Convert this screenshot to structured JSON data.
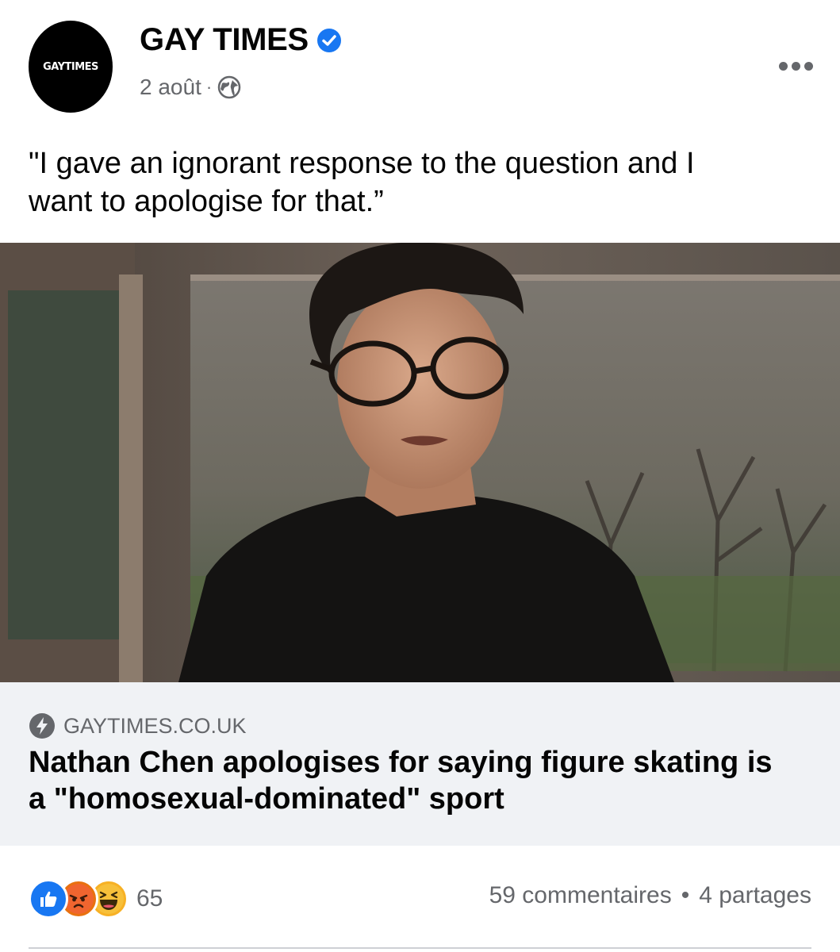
{
  "post": {
    "page_name": "GAY TIMES",
    "avatar_text": "GAYTIMES",
    "date": "2 août",
    "separator": "·",
    "caption_line1": "\"I gave an ignorant response to the question and I",
    "caption_line2": "want to apologise for that.”"
  },
  "link_preview": {
    "domain": "GAYTIMES.CO.UK",
    "headline_line1": "Nathan Chen apologises for saying figure skating is",
    "headline_line2": "a \"homosexual-dominated\" sport"
  },
  "engagement": {
    "reactions": [
      "like-icon",
      "angry-icon",
      "haha-icon"
    ],
    "reaction_count": "65",
    "comments": "59 commentaires",
    "dot": "•",
    "shares": "4 partages"
  },
  "colors": {
    "verified_blue": "#1877f2",
    "secondary_text": "#65676b",
    "link_bg": "#f0f2f5"
  }
}
